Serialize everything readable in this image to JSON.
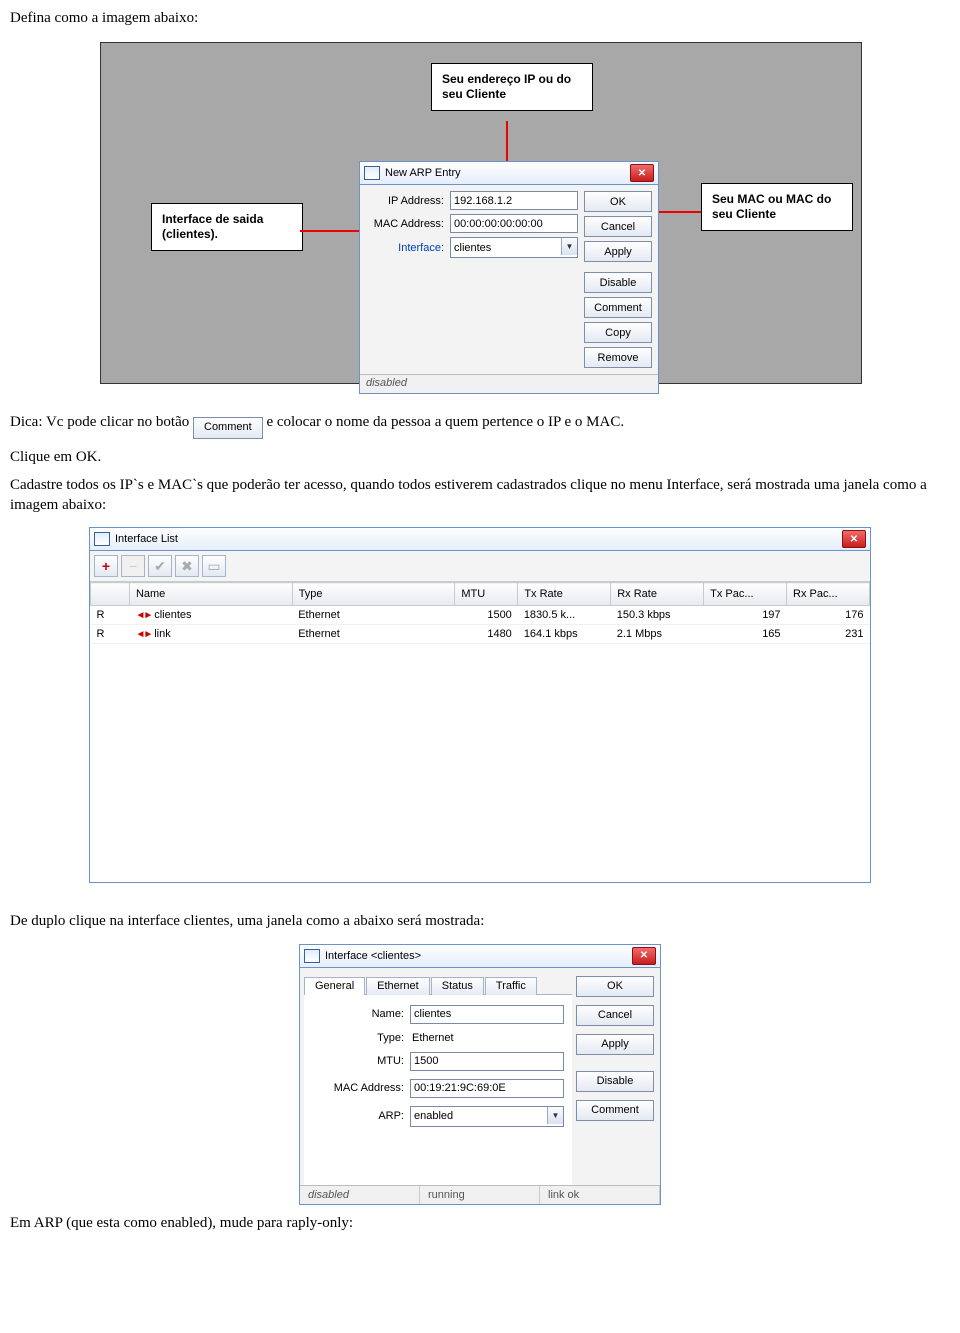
{
  "text": {
    "intro": "Defina como a imagem abaixo:",
    "tip_before": "Dica: Vc pode clicar no botão ",
    "tip_comment_btn": "Comment",
    "tip_after": " e colocar o nome da pessoa a quem pertence o IP e o MAC.",
    "click_ok": "Clique em OK.",
    "cadastre": "Cadastre todos os IP`s e MAC`s que poderão ter acesso, quando todos estiverem cadastrados clique no menu Interface, será mostrada uma janela como a imagem abaixo:",
    "dbl_click": "De duplo clique na interface clientes, uma janela como a abaixo será mostrada:",
    "arp_note": "Em ARP (que esta como enabled), mude para raply-only:"
  },
  "callouts": {
    "top": "Seu endereço IP ou do seu Cliente",
    "left": "Interface de saida (clientes).",
    "right": "Seu MAC ou MAC do seu Cliente"
  },
  "arp": {
    "title": "New ARP Entry",
    "ip_label": "IP Address:",
    "ip_value": "192.168.1.2",
    "mac_label": "MAC Address:",
    "mac_value": "00:00:00:00:00:00",
    "iface_label": "Interface:",
    "iface_value": "clientes",
    "buttons": {
      "ok": "OK",
      "cancel": "Cancel",
      "apply": "Apply",
      "disable": "Disable",
      "comment": "Comment",
      "copy": "Copy",
      "remove": "Remove"
    },
    "status": "disabled"
  },
  "iflist": {
    "title": "Interface List",
    "columns": [
      "",
      "Name",
      "Type",
      "MTU",
      "Tx Rate",
      "Rx Rate",
      "Tx Pac...",
      "Rx Pac..."
    ],
    "rows": [
      {
        "flag": "R",
        "name": "clientes",
        "type": "Ethernet",
        "mtu": "1500",
        "tx": "1830.5 k...",
        "rx": "150.3 kbps",
        "txp": "197",
        "rxp": "176"
      },
      {
        "flag": "R",
        "name": "link",
        "type": "Ethernet",
        "mtu": "1480",
        "tx": "164.1 kbps",
        "rx": "2.1 Mbps",
        "txp": "165",
        "rxp": "231"
      }
    ]
  },
  "ifprop": {
    "title": "Interface <clientes>",
    "tabs": [
      "General",
      "Ethernet",
      "Status",
      "Traffic"
    ],
    "name_label": "Name:",
    "name_value": "clientes",
    "type_label": "Type:",
    "type_value": "Ethernet",
    "mtu_label": "MTU:",
    "mtu_value": "1500",
    "mac_label": "MAC Address:",
    "mac_value": "00:19:21:9C:69:0E",
    "arp_label": "ARP:",
    "arp_value": "enabled",
    "buttons": {
      "ok": "OK",
      "cancel": "Cancel",
      "apply": "Apply",
      "disable": "Disable",
      "comment": "Comment"
    },
    "status": {
      "s1": "disabled",
      "s2": "running",
      "s3": "link ok"
    }
  }
}
